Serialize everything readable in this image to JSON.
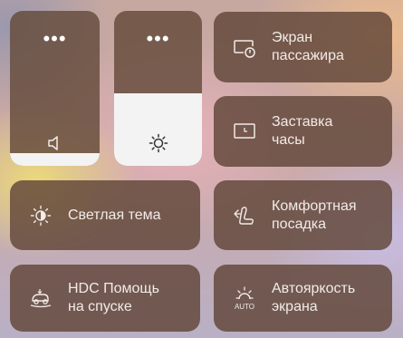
{
  "sliders": {
    "volume": {
      "menu_glyph": "•••",
      "icon": "speaker-icon",
      "level": 0.08
    },
    "brightness": {
      "menu_glyph": "•••",
      "icon": "sun-icon",
      "level": 0.47
    }
  },
  "tiles": {
    "passenger_screen": {
      "label": "Экран\nпассажира",
      "icon": "passenger-screen-icon"
    },
    "screensaver_clock": {
      "label": "Заставка\nчасы",
      "icon": "clock-screensaver-icon"
    },
    "light_theme": {
      "label": "Светлая тема",
      "icon": "sun-theme-icon"
    },
    "comfort_seating": {
      "label": "Комфортная\nпосадка",
      "icon": "seat-icon"
    },
    "hdc": {
      "label": "HDC Помощь\nна спуске",
      "icon": "hill-descent-icon"
    },
    "auto_brightness": {
      "label": "Автояркость\nэкрана",
      "icon": "auto-brightness-icon",
      "icon_text": "AUTO"
    }
  }
}
